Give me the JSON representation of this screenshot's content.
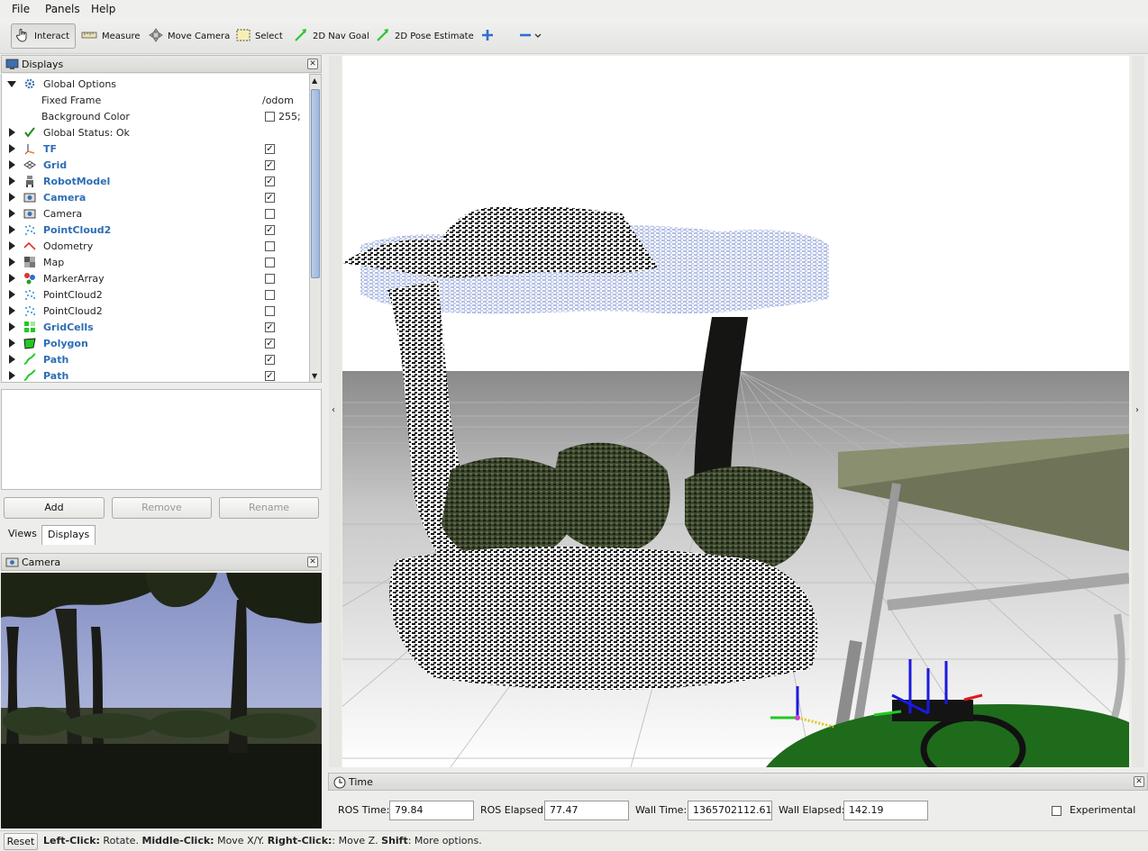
{
  "menu": {
    "file": "File",
    "panels": "Panels",
    "help": "Help"
  },
  "toolbar": {
    "interact": "Interact",
    "measure": "Measure",
    "move_camera": "Move Camera",
    "select": "Select",
    "nav_goal": "2D Nav Goal",
    "pose_estimate": "2D Pose Estimate"
  },
  "displays_panel": {
    "title": "Displays",
    "rows": [
      {
        "label": "Global Options",
        "bold": false,
        "checked": null
      },
      {
        "label": "Fixed Frame",
        "value": "/odom"
      },
      {
        "label": "Background Color",
        "value": "255;"
      },
      {
        "label": "Global Status: Ok",
        "bold": false,
        "checked": null
      },
      {
        "label": "TF",
        "bold": true,
        "checked": true
      },
      {
        "label": "Grid",
        "bold": true,
        "checked": true
      },
      {
        "label": "RobotModel",
        "bold": true,
        "checked": true
      },
      {
        "label": "Camera",
        "bold": true,
        "checked": true
      },
      {
        "label": "Camera",
        "bold": false,
        "checked": false
      },
      {
        "label": "PointCloud2",
        "bold": true,
        "checked": true
      },
      {
        "label": "Odometry",
        "bold": false,
        "checked": false
      },
      {
        "label": "Map",
        "bold": false,
        "checked": false
      },
      {
        "label": "MarkerArray",
        "bold": false,
        "checked": false
      },
      {
        "label": "PointCloud2",
        "bold": false,
        "checked": false
      },
      {
        "label": "PointCloud2",
        "bold": false,
        "checked": false
      },
      {
        "label": "GridCells",
        "bold": true,
        "checked": true
      },
      {
        "label": "Polygon",
        "bold": true,
        "checked": true
      },
      {
        "label": "Path",
        "bold": true,
        "checked": true
      },
      {
        "label": "Path",
        "bold": true,
        "checked": true
      }
    ],
    "add": "Add",
    "remove": "Remove",
    "rename": "Rename"
  },
  "tabs": {
    "views": "Views",
    "displays": "Displays"
  },
  "camera_panel": {
    "title": "Camera"
  },
  "time_panel": {
    "title": "Time",
    "ros_time_label": "ROS Time:",
    "ros_time": "79.84",
    "ros_elapsed_label": "ROS Elapsed:",
    "ros_elapsed": "77.47",
    "wall_time_label": "Wall Time:",
    "wall_time": "1365702112.61",
    "wall_elapsed_label": "Wall Elapsed:",
    "wall_elapsed": "142.19",
    "experimental": "Experimental"
  },
  "status": {
    "reset": "Reset",
    "left_click": "Left-Click:",
    "left_desc": " Rotate. ",
    "middle_click": "Middle-Click:",
    "middle_desc": " Move X/Y. ",
    "right_click": "Right-Click:",
    "right_desc": ": Move Z. ",
    "shift": "Shift",
    "shift_desc": ": More options."
  },
  "colors": {
    "accent_blue": "#2d6db5",
    "sky": "#8d9ac6",
    "cloud_blue": "#b3bfe6",
    "robot_green": "#1f6b1c"
  }
}
